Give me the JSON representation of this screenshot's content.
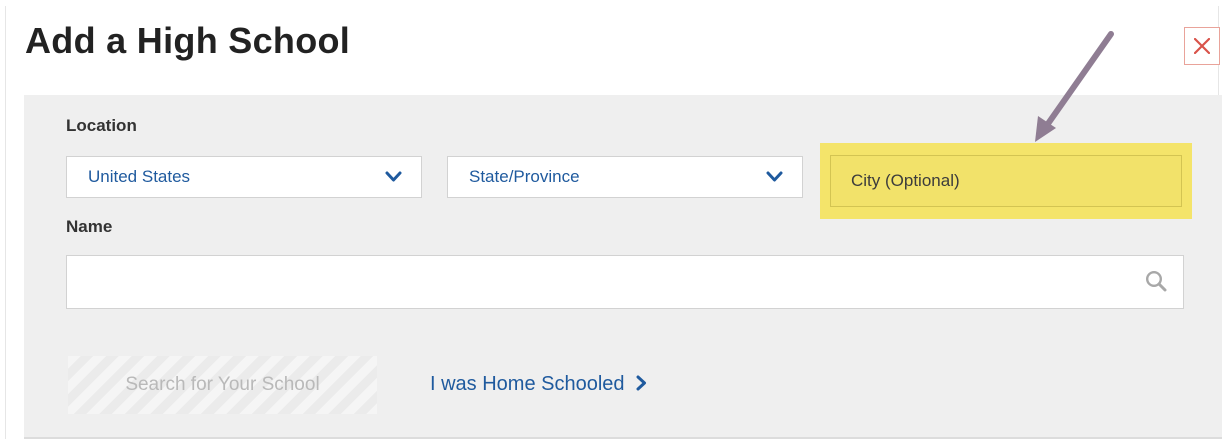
{
  "dialog": {
    "title": "Add a High School",
    "close_icon": "close-icon"
  },
  "location": {
    "label": "Location",
    "country": {
      "selected": "United States",
      "icon": "chevron-down-icon"
    },
    "state": {
      "selected": "State/Province",
      "icon": "chevron-down-icon"
    },
    "city": {
      "placeholder": "City (Optional)",
      "value": ""
    }
  },
  "name": {
    "label": "Name",
    "value": "",
    "icon": "search-icon"
  },
  "actions": {
    "search_label": "Search for Your School",
    "home_schooled_label": "I was Home Schooled",
    "home_schooled_icon": "chevron-right-icon"
  },
  "annotation": {
    "arrow_color": "#8f7d93",
    "highlight_color": "#f4e46a"
  },
  "colors": {
    "link_blue": "#1f5a9e",
    "panel_gray": "#efefef",
    "close_red": "#d9534a"
  }
}
